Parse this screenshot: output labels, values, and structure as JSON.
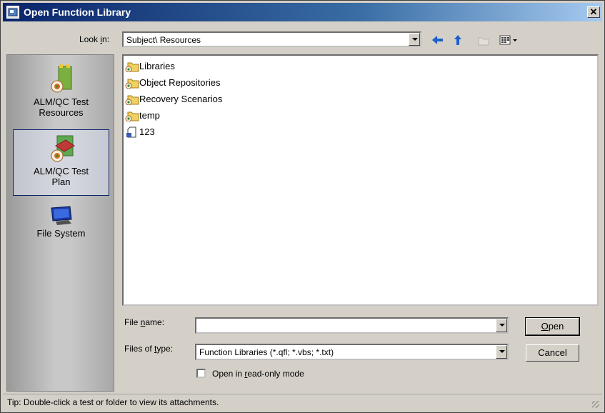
{
  "window": {
    "title": "Open Function Library",
    "close_glyph": "✕"
  },
  "lookin": {
    "label_pre": "Look ",
    "label_accel": "i",
    "label_post": "n:",
    "value": "Subject\\ Resources"
  },
  "toolbar": {
    "icons": [
      "back-arrow-icon",
      "up-folder-icon",
      "new-folder-icon",
      "view-menu-icon"
    ]
  },
  "places": [
    {
      "label_line1": "ALM/QC Test",
      "label_line2": "Resources",
      "icon": "test-resources-icon",
      "selected": false
    },
    {
      "label_line1": "ALM/QC Test",
      "label_line2": "Plan",
      "icon": "test-plan-icon",
      "selected": true
    },
    {
      "label_line1": "File System",
      "label_line2": "",
      "icon": "computer-icon",
      "selected": false
    }
  ],
  "files": [
    {
      "name": "Libraries",
      "type": "folder"
    },
    {
      "name": "Object Repositories",
      "type": "folder"
    },
    {
      "name": "Recovery Scenarios",
      "type": "folder"
    },
    {
      "name": "temp",
      "type": "folder"
    },
    {
      "name": "123",
      "type": "file"
    }
  ],
  "filename": {
    "label_pre": "File ",
    "label_accel": "n",
    "label_post": "ame:",
    "value": ""
  },
  "filetype": {
    "label_pre": "Files of ",
    "label_accel": "t",
    "label_post": "ype:",
    "value": "Function Libraries (*.qfl; *.vbs; *.txt)"
  },
  "buttons": {
    "open_accel": "O",
    "open_rest": "pen",
    "cancel": "Cancel"
  },
  "readonly": {
    "label_pre": "Open in ",
    "label_accel": "r",
    "label_post": "ead-only mode",
    "checked": false
  },
  "statusbar": {
    "tip": "Tip: Double-click a test or folder to view its attachments."
  },
  "colors": {
    "title_start": "#0a246a",
    "title_end": "#a6caf0",
    "face": "#d4d0c8",
    "selection_border": "#0a246a"
  }
}
